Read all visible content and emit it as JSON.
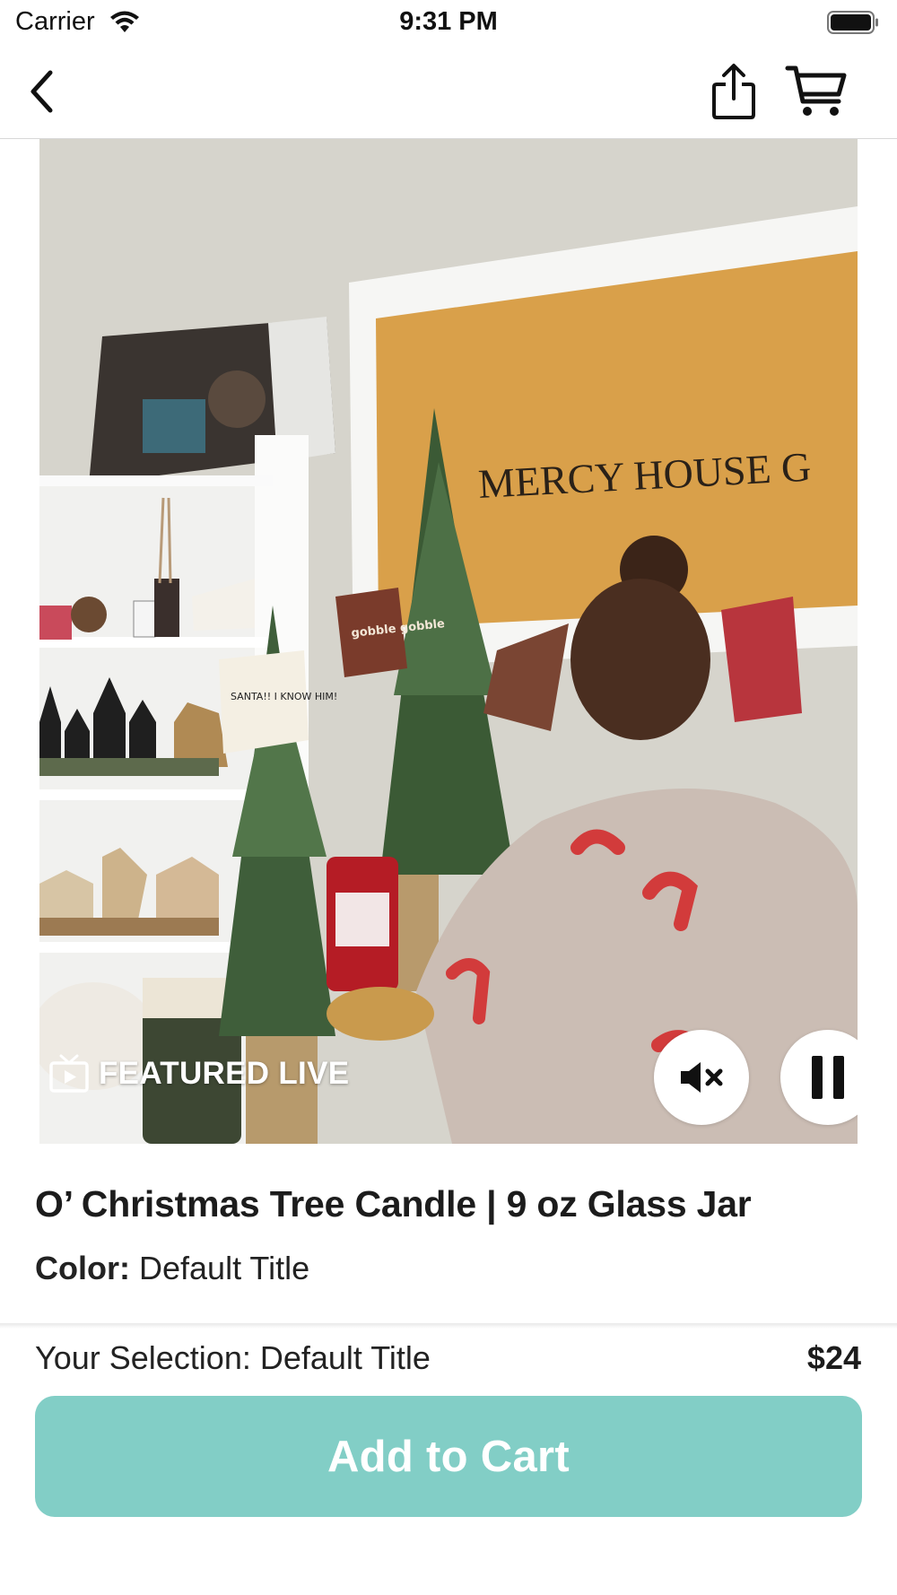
{
  "status_bar": {
    "carrier": "Carrier",
    "time": "9:31 PM"
  },
  "nav": {
    "back_icon": "chevron-left-icon",
    "share_icon": "share-icon",
    "cart_icon": "cart-icon"
  },
  "video": {
    "badge_icon": "tv-play-icon",
    "badge_label": "FEATURED LIVE",
    "mute_icon": "speaker-muted-icon",
    "pause_icon": "pause-icon",
    "scene_text": {
      "sign": "MERCY HOUSE G",
      "tag_gobble": "gobble gobble",
      "tag_santa": "SANTA!! I KNOW HIM!"
    }
  },
  "product": {
    "title": "O’ Christmas Tree Candle | 9 oz Glass Jar",
    "color_label": "Color:",
    "color_value": "Default Title",
    "selection_text": "Your Selection: Default Title",
    "price": "$24",
    "add_to_cart_label": "Add to Cart"
  },
  "colors": {
    "accent": "#82cec6",
    "sign_orange": "#d9a04a"
  }
}
